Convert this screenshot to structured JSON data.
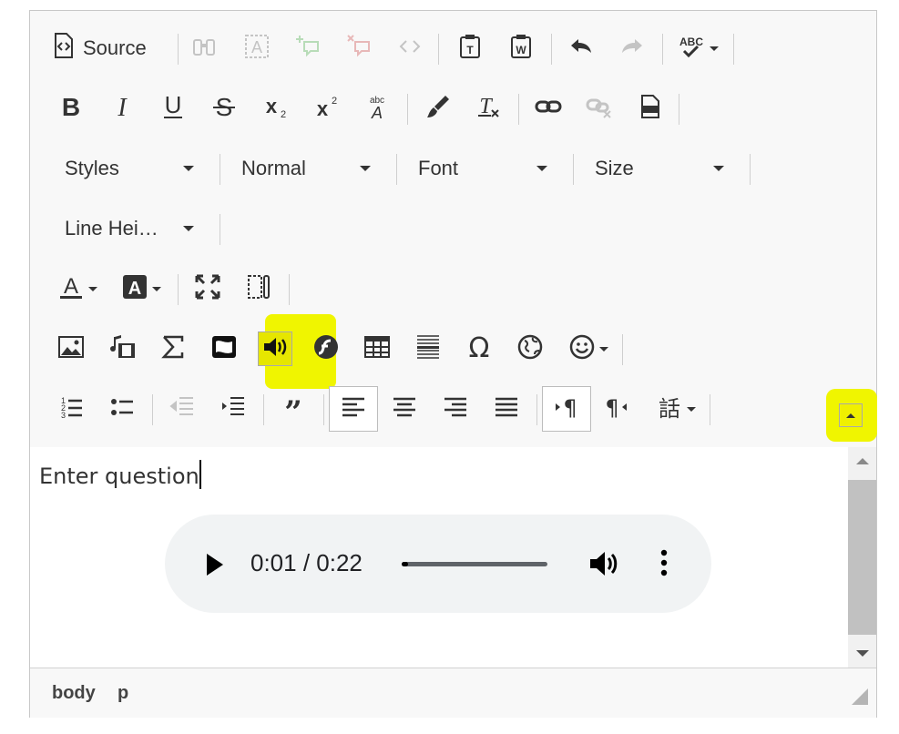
{
  "toolbar": {
    "source_label": "Source",
    "styles_label": "Styles",
    "format_label": "Normal",
    "font_label": "Font",
    "size_label": "Size",
    "line_height_label": "Line Hei…"
  },
  "content": {
    "text": "Enter question",
    "audio": {
      "current_time": "0:01",
      "duration": "0:22",
      "time_display": "0:01 / 0:22",
      "progress": 0.0455
    }
  },
  "statusbar": {
    "path": [
      "body",
      "p"
    ]
  },
  "colors": {
    "highlight": "#f0f500",
    "icon": "#333333",
    "disabled_icon": "#9a9a9a",
    "player_bg": "#f1f3f4"
  }
}
